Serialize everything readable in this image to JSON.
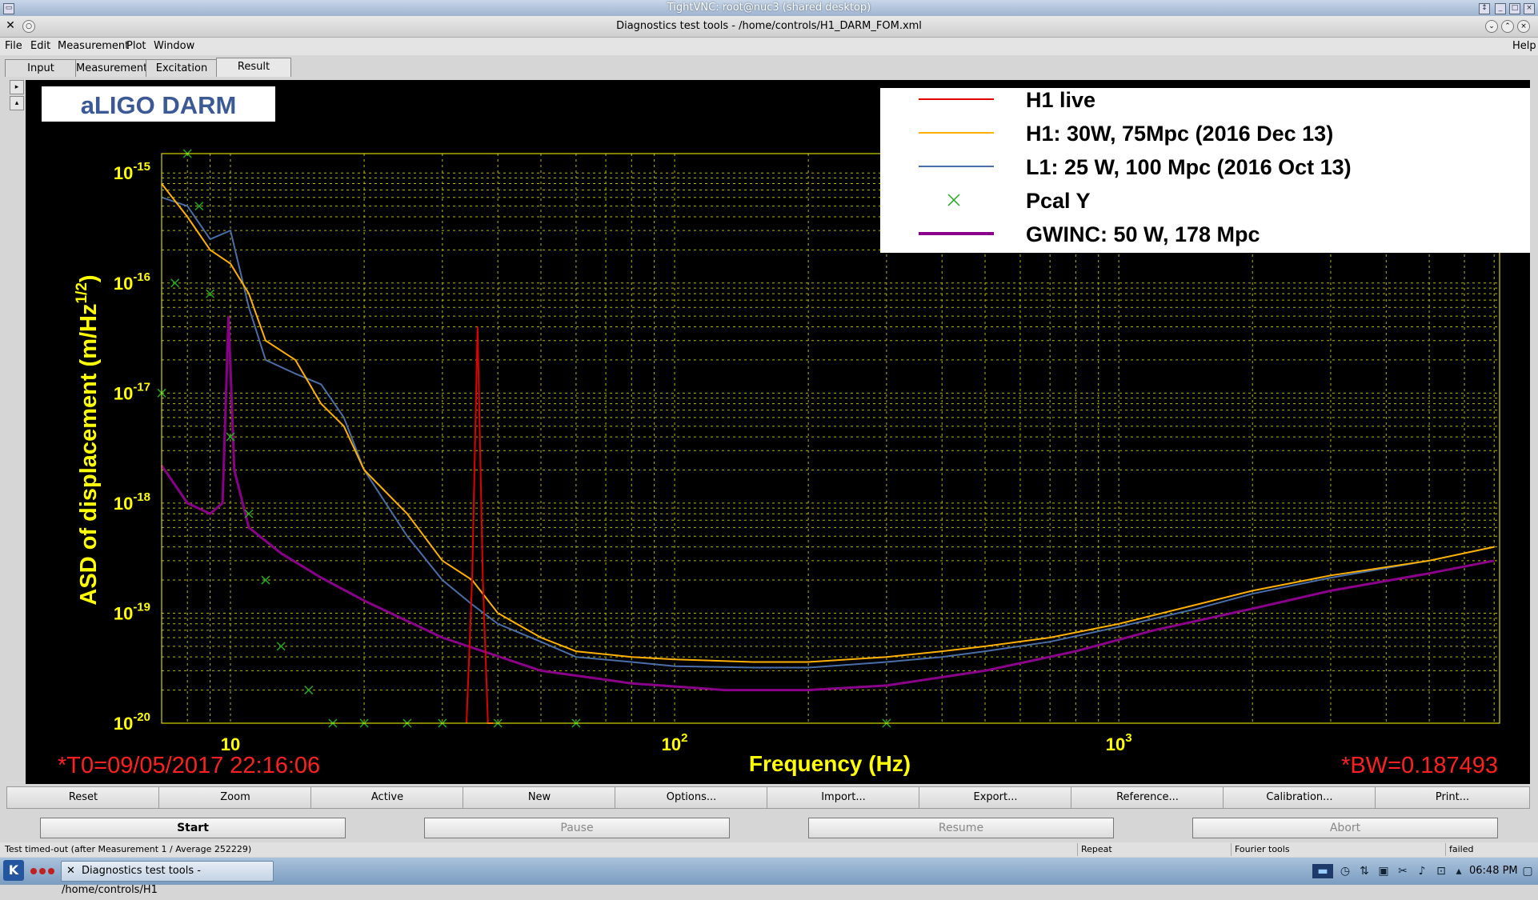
{
  "vnc": {
    "title": "TightVNC: root@nuc3 (shared desktop)"
  },
  "window": {
    "title": "Diagnostics test tools - /home/controls/H1_DARM_FOM.xml"
  },
  "menu": {
    "items": [
      "File",
      "Edit",
      "Measurement",
      "Plot",
      "Window"
    ],
    "help": "Help"
  },
  "tabs": [
    {
      "label": "Input"
    },
    {
      "label": "Measurement"
    },
    {
      "label": "Excitation"
    },
    {
      "label": "Result",
      "selected": true
    }
  ],
  "plot": {
    "title_box": "aLIGO DARM",
    "ylabel": "ASD of displacement (m/Hz",
    "ylabel_sup": "1/2",
    "ylabel_close": ")",
    "xlabel": "Frequency (Hz)",
    "t0": "*T0=09/05/2017 22:16:06",
    "bw": "*BW=0.187493",
    "y_ticks": [
      {
        "base": "10",
        "exp": "-15"
      },
      {
        "base": "10",
        "exp": "-16"
      },
      {
        "base": "10",
        "exp": "-17"
      },
      {
        "base": "10",
        "exp": "-18"
      },
      {
        "base": "10",
        "exp": "-19"
      },
      {
        "base": "10",
        "exp": "-20"
      }
    ],
    "x_ticks": [
      {
        "base": "10",
        "exp": ""
      },
      {
        "base": "10",
        "exp": "2"
      },
      {
        "base": "10",
        "exp": "3"
      }
    ],
    "legend": [
      {
        "label": "H1 live",
        "color": "#e00000",
        "kind": "line"
      },
      {
        "label": "H1: 30W, 75Mpc (2016 Dec 13)",
        "color": "#ffb000",
        "kind": "line"
      },
      {
        "label": "L1: 25 W, 100 Mpc (2016 Oct 13)",
        "color": "#4a6ea8",
        "kind": "line"
      },
      {
        "label": "Pcal Y",
        "color": "#22aa22",
        "kind": "marker"
      },
      {
        "label": "GWINC: 50 W, 178 Mpc",
        "color": "#8b008b",
        "kind": "thick"
      }
    ],
    "colors": {
      "axis": "#ffff00",
      "grid": "#b8b800",
      "background": "#000000"
    }
  },
  "chart_data": {
    "type": "line",
    "log_x": true,
    "log_y": true,
    "xlim": [
      7,
      7200
    ],
    "ylim": [
      1e-20,
      1.5e-15
    ],
    "grid": true,
    "legend_position": "top-right",
    "series": [
      {
        "name": "GWINC: 50 W, 178 Mpc",
        "x": [
          7,
          8,
          9,
          9.6,
          9.9,
          10.2,
          11,
          13,
          16,
          20,
          30,
          50,
          80,
          130,
          200,
          300,
          500,
          800,
          1200,
          2000,
          3000,
          5000,
          7000
        ],
        "y": [
          2.2e-18,
          1e-18,
          8e-19,
          1e-18,
          5e-17,
          2e-18,
          6e-19,
          3.5e-19,
          2.1e-19,
          1.3e-19,
          6e-20,
          3e-20,
          2.3e-20,
          2e-20,
          2e-20,
          2.2e-20,
          3e-20,
          4.5e-20,
          7e-20,
          1.1e-19,
          1.6e-19,
          2.3e-19,
          3e-19
        ]
      },
      {
        "name": "H1: 30W, 75Mpc (2016 Dec 13)",
        "x": [
          7,
          8,
          9,
          10,
          11,
          12,
          14,
          16,
          18,
          20,
          25,
          30,
          35,
          40,
          50,
          60,
          80,
          100,
          150,
          200,
          300,
          400,
          500,
          700,
          1000,
          1500,
          2000,
          3000,
          5000,
          7000
        ],
        "y": [
          8e-16,
          4e-16,
          2e-16,
          1.5e-16,
          8e-17,
          3e-17,
          2e-17,
          8e-18,
          5e-18,
          2e-18,
          8e-19,
          3e-19,
          2e-19,
          1e-19,
          6e-20,
          4.5e-20,
          4e-20,
          3.8e-20,
          3.6e-20,
          3.6e-20,
          4e-20,
          4.5e-20,
          5e-20,
          6e-20,
          8e-20,
          1.2e-19,
          1.6e-19,
          2.2e-19,
          3e-19,
          4e-19
        ]
      },
      {
        "name": "L1: 25 W, 100 Mpc (2016 Oct 13)",
        "x": [
          7,
          8,
          9,
          10,
          11,
          12,
          14,
          16,
          18,
          20,
          25,
          30,
          35,
          40,
          50,
          60,
          80,
          100,
          150,
          200,
          300,
          400,
          500,
          700,
          1000,
          1500,
          2000,
          3000,
          5000,
          7000
        ],
        "y": [
          6e-16,
          5e-16,
          2.5e-16,
          3e-16,
          6e-17,
          2e-17,
          1.5e-17,
          1.2e-17,
          6e-18,
          2e-18,
          5e-19,
          2e-19,
          1.2e-19,
          8e-20,
          5.5e-20,
          4e-20,
          3.6e-20,
          3.3e-20,
          3.2e-20,
          3.2e-20,
          3.6e-20,
          4e-20,
          4.5e-20,
          5.5e-20,
          7.5e-20,
          1.1e-19,
          1.5e-19,
          2.1e-19,
          3e-19,
          4e-19
        ]
      },
      {
        "name": "H1 live",
        "x": [
          34,
          35,
          36,
          37,
          38,
          39
        ],
        "y": [
          1e-20,
          2e-19,
          4e-17,
          2e-19,
          1e-20,
          1e-20
        ]
      },
      {
        "name": "Pcal Y",
        "x": [
          7,
          7.5,
          8,
          8.5,
          9,
          10,
          11,
          12,
          13,
          15,
          17,
          20,
          25,
          30,
          40,
          60,
          300
        ],
        "y": [
          1e-17,
          1e-16,
          1.5e-15,
          5e-16,
          8e-17,
          4e-18,
          8e-19,
          2e-19,
          5e-20,
          2e-20,
          1e-20,
          1e-20,
          1e-20,
          1e-20,
          1e-20,
          1e-20,
          1e-20
        ]
      }
    ]
  },
  "buttons_row1": [
    "Reset",
    "Zoom",
    "Active",
    "New",
    "Options...",
    "Import...",
    "Export...",
    "Reference...",
    "Calibration...",
    "Print..."
  ],
  "buttons_row2": [
    {
      "label": "Start",
      "enabled": true
    },
    {
      "label": "Pause",
      "enabled": false
    },
    {
      "label": "Resume",
      "enabled": false
    },
    {
      "label": "Abort",
      "enabled": false
    }
  ],
  "status": {
    "message": "Test timed-out (after Measurement 1 / Average 252229)",
    "repeat": "Repeat",
    "tool": "Fourier tools",
    "state": "failed"
  },
  "taskbar": {
    "task": "Diagnostics test tools - /home/controls/H1",
    "clock": "06:48 PM"
  }
}
